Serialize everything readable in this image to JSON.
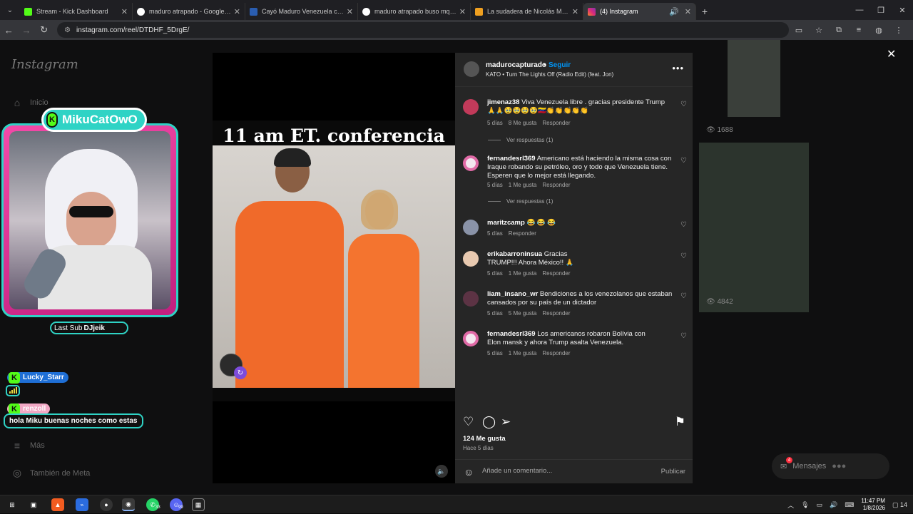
{
  "browser": {
    "tabs": [
      {
        "title": "Stream - Kick Dashboard",
        "favicon_color": "#53fc18",
        "active": false
      },
      {
        "title": "maduro atrapado - Google Sea",
        "favicon_color": "#ffffff",
        "active": false
      },
      {
        "title": "Cayó Maduro Venezuela celebr",
        "favicon_color": "#2a5db0",
        "active": false
      },
      {
        "title": "maduro atrapado buso mque n",
        "favicon_color": "#ffffff",
        "active": false
      },
      {
        "title": "La sudadera de Nicolás Maduro",
        "favicon_color": "#f0a020",
        "active": false
      },
      {
        "title": "(4) Instagram",
        "favicon_color": "#d62976",
        "active": true
      }
    ],
    "url": "instagram.com/reel/DTDHF_5DrgE/"
  },
  "instagram": {
    "logo": "Instagram",
    "nav_home": "Inicio",
    "nav_more": "Más",
    "nav_meta": "También de Meta",
    "bg_views": [
      "1688",
      "4842"
    ],
    "messages_label": "Mensajes",
    "messages_count": "4"
  },
  "stream_overlay": {
    "brand": "MikuCatOwO",
    "last_sub_label": "Last Sub",
    "last_sub_name": "DJjeik",
    "chat": [
      {
        "user": "Lucky_Starr",
        "message": ""
      },
      {
        "user": "renzoll",
        "message": "hola Miku buenas noches como estas"
      }
    ]
  },
  "reel": {
    "caption": "11 am ET. conferencia",
    "username": "madurocapturado",
    "follow": "Seguir",
    "song": "KATO • Turn The Lights Off (Radio Edit) (feat. Jon)",
    "likes": "124 Me gusta",
    "posted": "Hace 5 días",
    "comment_placeholder": "Añade un comentario...",
    "publish": "Publicar",
    "comments": [
      {
        "user": "jimenaz38",
        "text": "Viva Venezuela libre . gracias presidente Trump 🙏🙏🥹🥹🥹🥹🇻🇪👏👏👏👏👏",
        "age": "5 días",
        "likes": "8 Me gusta",
        "reply": "Responder",
        "replies": "Ver respuestas (1)",
        "avatar": "#c23a5a"
      },
      {
        "user": "fernandesrl369",
        "text": "Americano está haciendo la misma cosa con Iraque robando su petróleo, oro y todo que Venezuela tiene. Esperen que lo mejor está llegando.",
        "age": "5 días",
        "likes": "1 Me gusta",
        "reply": "Responder",
        "replies": "Ver respuestas (1)",
        "avatar": "#f3e6ef"
      },
      {
        "user": "maritzcamp",
        "text": "😂 😂 😂",
        "age": "5 días",
        "likes": "",
        "reply": "Responder",
        "replies": "",
        "avatar": "#8a93a8"
      },
      {
        "user": "erikabarroninsua",
        "text": "Gracias TRUMP!!! Ahora México!! 🙏",
        "age": "5 días",
        "likes": "1 Me gusta",
        "reply": "Responder",
        "replies": "",
        "avatar": "#e8c9b0"
      },
      {
        "user": "liam_insano_wr",
        "text": "Bendiciones a los venezolanos que estaban cansados por su país de un dictador",
        "age": "5 días",
        "likes": "5 Me gusta",
        "reply": "Responder",
        "replies": "",
        "avatar": "#5c3344"
      },
      {
        "user": "fernandesrl369",
        "text": "Los americanos robaron Bolívia con Elon mansk y ahora Trump asalta Venezuela.",
        "age": "5 días",
        "likes": "1 Me gusta",
        "reply": "Responder",
        "replies": "",
        "avatar": "#f3e6ef"
      }
    ]
  },
  "taskbar": {
    "whatsapp_count": "33",
    "discord_count": "99",
    "time": "11:47 PM",
    "date": "1/8/2026",
    "notifications": "14"
  },
  "colors": {
    "accent_link": "#0095f6",
    "kick_green": "#53fc18",
    "overlay_teal": "#2fd3c5",
    "overlay_pink": "#f34aa8"
  }
}
